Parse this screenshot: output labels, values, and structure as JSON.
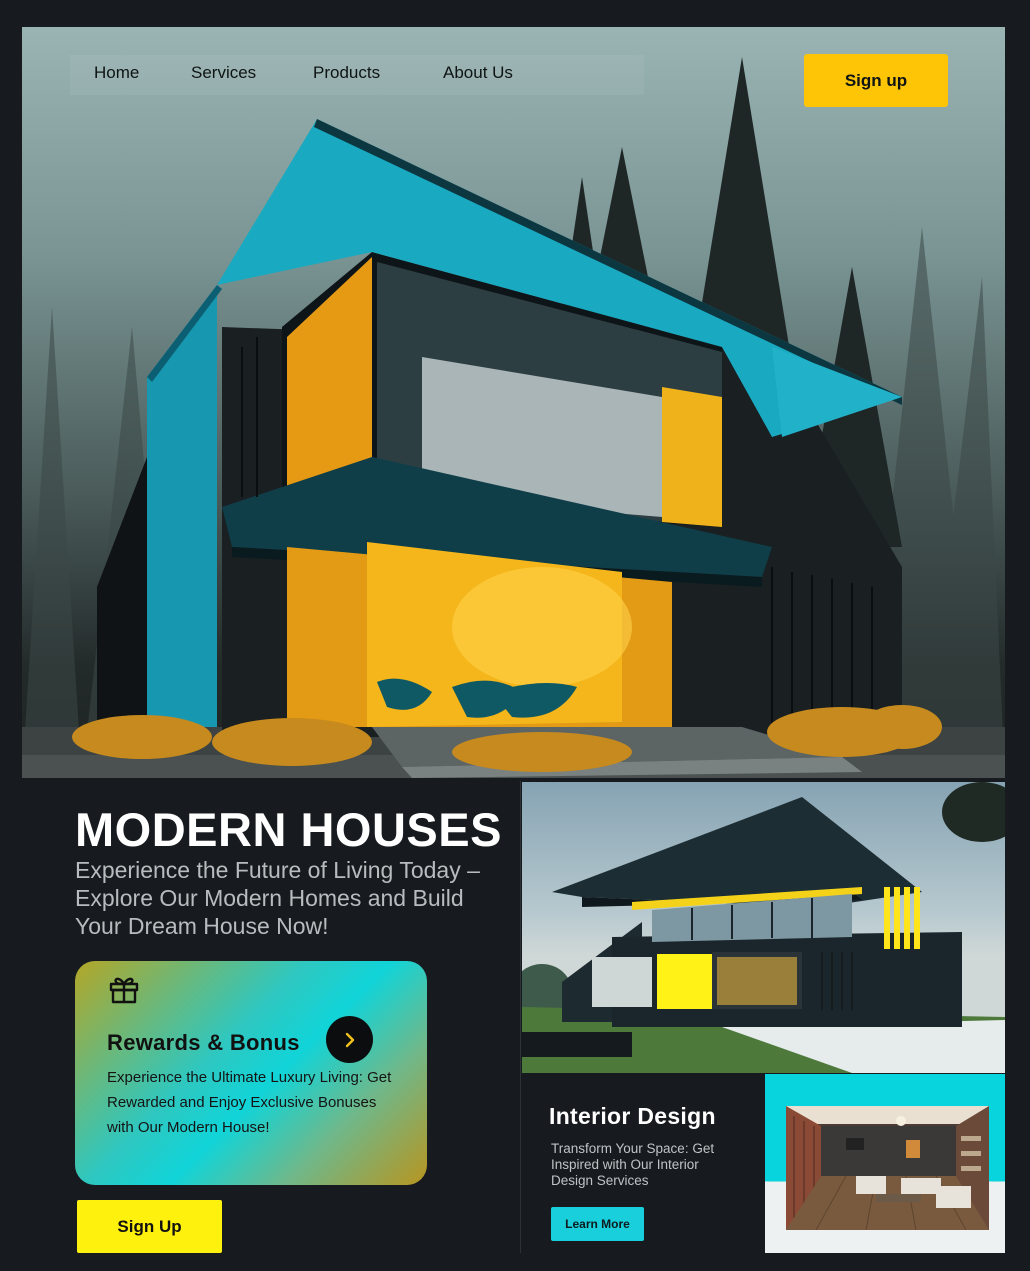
{
  "nav": {
    "items": [
      "Home",
      "Services",
      "Products",
      "About Us"
    ],
    "signup_label": "Sign up"
  },
  "hero": {
    "title": "MODERN HOUSES",
    "subtitle": "Experience the Future of Living Today – Explore Our Modern Homes and Build Your Dream House Now!"
  },
  "rewards": {
    "title": "Rewards & Bonus",
    "text": "Experience the Ultimate Luxury Living: Get Rewarded and Enjoy Exclusive Bonuses with Our Modern House!",
    "icon": "gift-icon",
    "arrow_icon": "chevron-right-icon"
  },
  "signup_bottom_label": "Sign Up",
  "interior": {
    "title": "Interior Design",
    "text": "Transform Your Space: Get Inspired with Our Interior Design Services",
    "button_label": "Learn More"
  },
  "colors": {
    "background": "#171b1f",
    "accent_yellow": "#fdc506",
    "bright_yellow": "#fff10e",
    "accent_cyan": "#19cfdc"
  }
}
